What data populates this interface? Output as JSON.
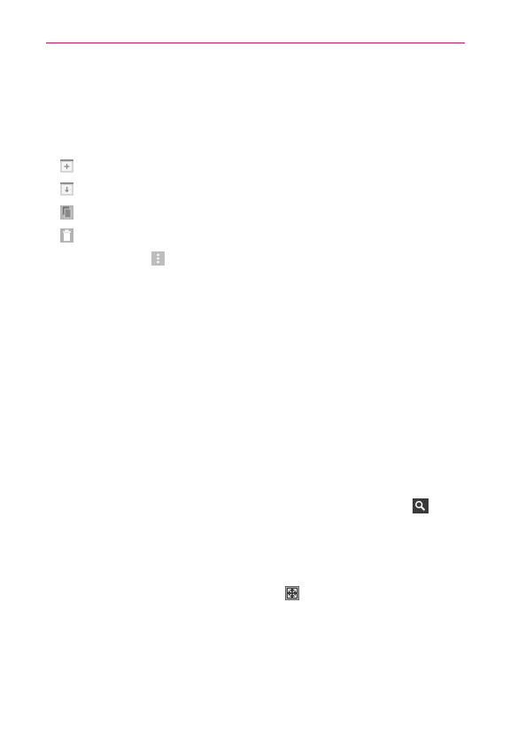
{
  "page": {
    "accent_color": "#c2185b",
    "icon_color": "#9e9e9e",
    "icons": [
      "new-folder-icon",
      "download-folder-icon",
      "copy-icon",
      "trash-icon",
      "overflow-menu-icon",
      "search-icon",
      "collapse-icon"
    ]
  }
}
